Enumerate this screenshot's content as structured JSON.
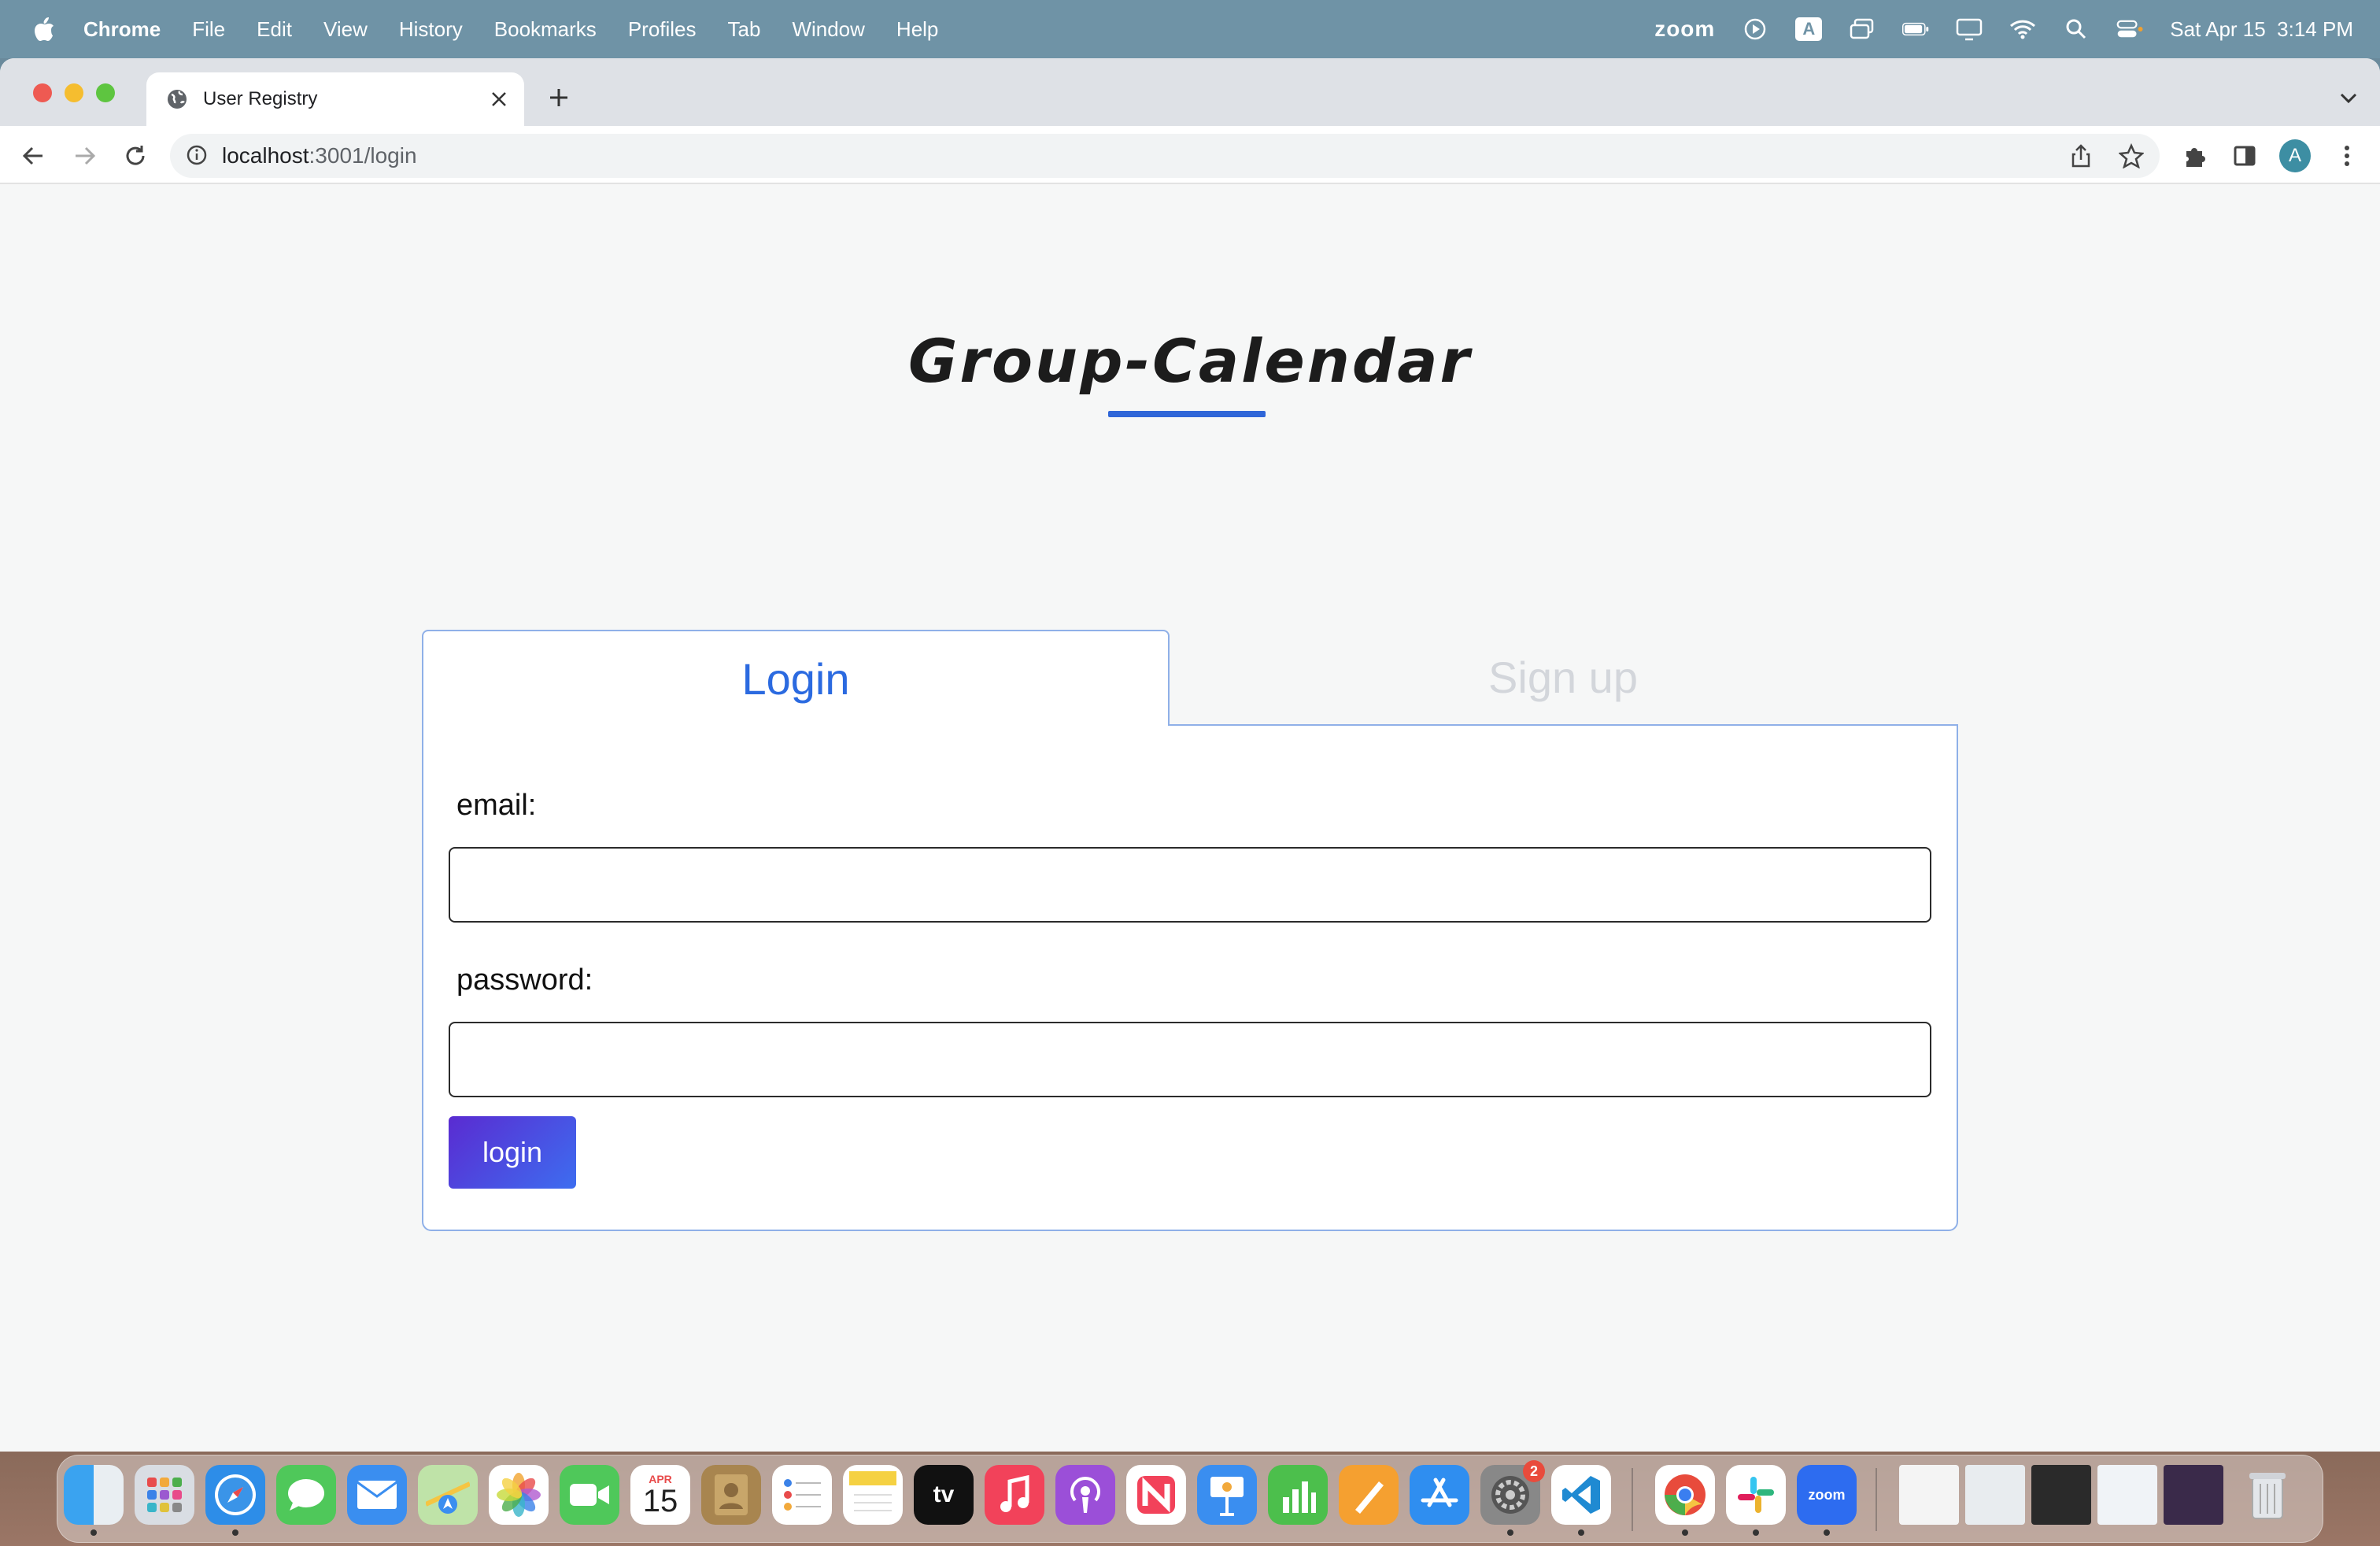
{
  "menubar": {
    "app_name": "Chrome",
    "items": [
      "File",
      "Edit",
      "View",
      "History",
      "Bookmarks",
      "Profiles",
      "Tab",
      "Window",
      "Help"
    ],
    "zoom_label": "zoom",
    "input_source": "A",
    "datetime": "Sat Apr 15  3:14 PM"
  },
  "browser": {
    "tab_title": "User Registry",
    "url_host": "localhost",
    "url_path": ":3001/login",
    "profile_initial": "A"
  },
  "page": {
    "title": "Group-Calendar",
    "tabs": {
      "login": "Login",
      "signup": "Sign up"
    },
    "form": {
      "email_label": "email:",
      "email_value": "",
      "password_label": "password:",
      "password_value": "",
      "submit_label": "login"
    }
  },
  "dock": {
    "calendar_month": "APR",
    "calendar_day": "15",
    "settings_badge": "2",
    "zoom_label": "zoom",
    "tv_label": "tv"
  },
  "colors": {
    "accent": "#2b6ae0",
    "tab_border": "#8fb0e8",
    "button_gradient_start": "#5a2bd1",
    "button_gradient_end": "#3d6df0",
    "inactive_tab_text": "#d3d6db"
  }
}
